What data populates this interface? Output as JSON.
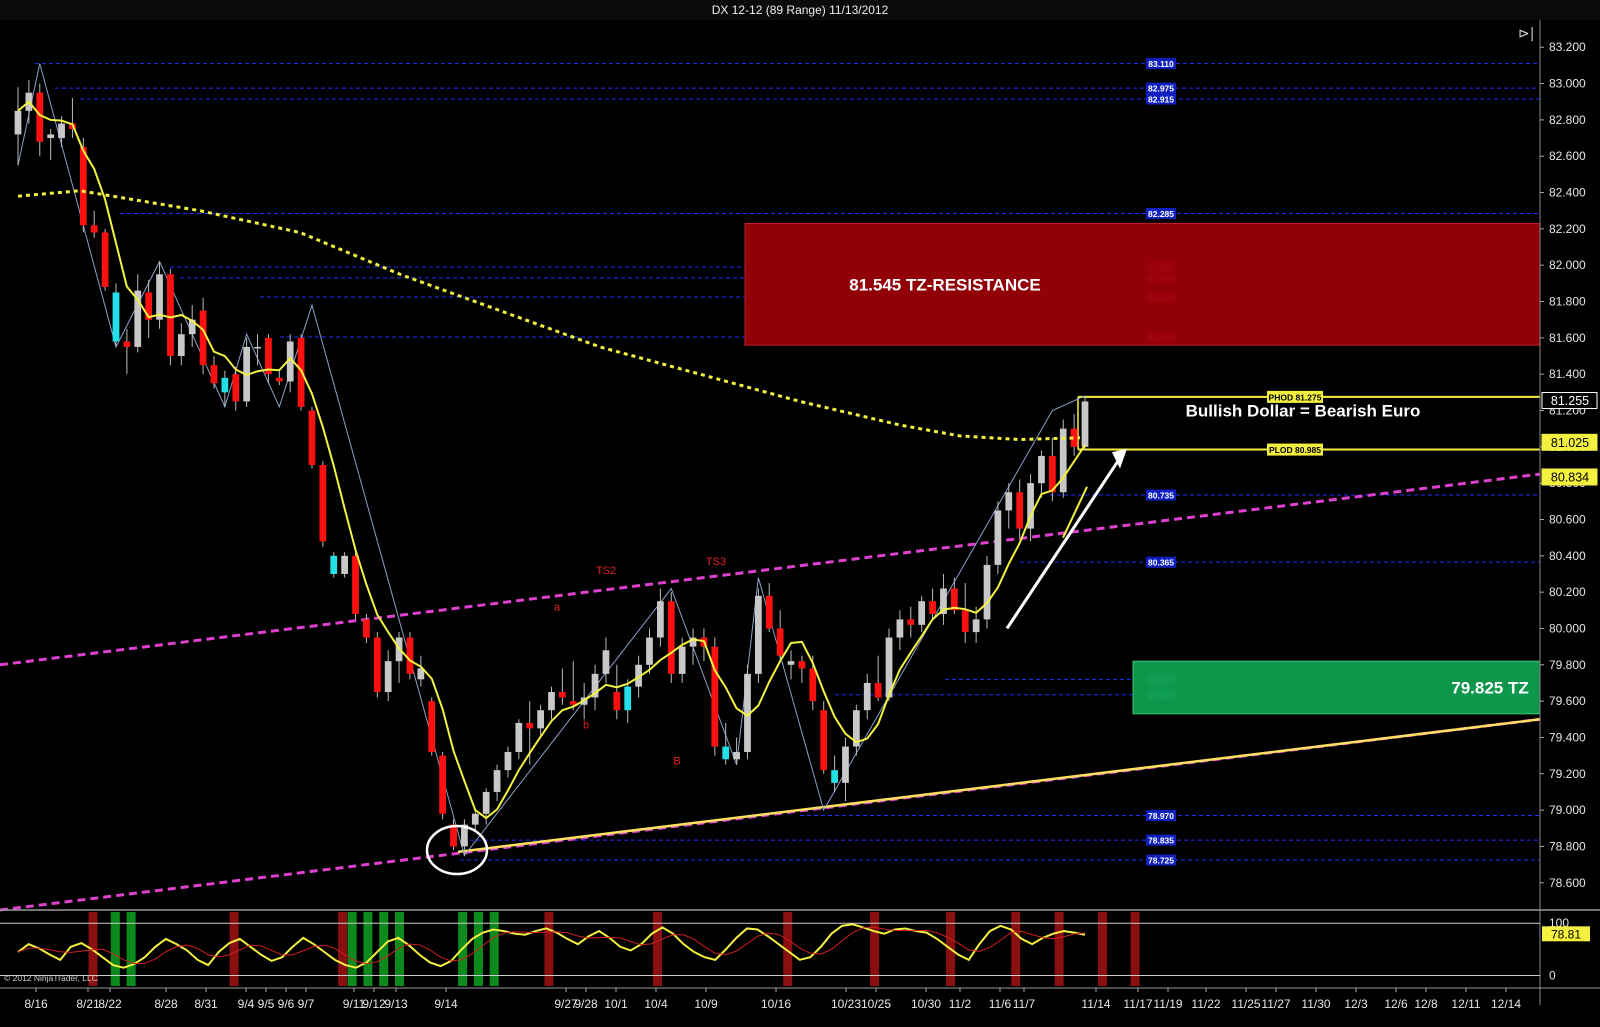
{
  "window": {
    "title": "DX 12-12 (89 Range)  11/13/2012"
  },
  "copyright": "© 2012 NinjaTrader, LLC",
  "colors": {
    "background": "#000000",
    "bull_candle": "#c8c8c8",
    "bear_candle": "#ff1010",
    "highlight_candle": "#22e0e8",
    "fast_ma": "#f2f240",
    "slow_ma": "#f2f240",
    "channel": "#e040d0",
    "level_line": "#2030ff",
    "resistance_zone": "#9a0008",
    "support_zone": "#0fa050"
  },
  "chart_data": {
    "type": "candlestick",
    "instrument": "DX 12-12",
    "ylim": [
      78.45,
      83.35
    ],
    "y_ticks": [
      "83.200",
      "83.000",
      "82.800",
      "82.600",
      "82.400",
      "82.200",
      "82.000",
      "81.800",
      "81.600",
      "81.400",
      "81.200",
      "81.000",
      "80.800",
      "80.600",
      "80.400",
      "80.200",
      "80.000",
      "79.800",
      "79.600",
      "79.400",
      "79.200",
      "79.000",
      "78.800",
      "78.600"
    ],
    "x_labels": [
      "8/16",
      "8/21",
      "8/22",
      "8/28",
      "8/31",
      "9/4",
      "9/5",
      "9/6",
      "9/7",
      "9/11",
      "9/12",
      "9/13",
      "9/14",
      "9/27",
      "9/28",
      "10/1",
      "10/4",
      "10/9",
      "10/16",
      "10/23",
      "10/25",
      "10/30",
      "11/2",
      "11/6",
      "11/7",
      "11/14",
      "11/17",
      "11/19",
      "11/22",
      "11/25",
      "11/27",
      "11/30",
      "12/3",
      "12/6",
      "12/8",
      "12/11",
      "12/14"
    ],
    "price_levels": [
      {
        "label": "83.110",
        "value": 83.11,
        "color": "#2030ff"
      },
      {
        "label": "82.975",
        "value": 82.975,
        "color": "#2030ff"
      },
      {
        "label": "82.915",
        "value": 82.915,
        "color": "#2030ff"
      },
      {
        "label": "82.285",
        "value": 82.285,
        "color": "#2030ff"
      },
      {
        "label": "81.990",
        "value": 81.99,
        "color": "#e050c0"
      },
      {
        "label": "81.930",
        "value": 81.93,
        "color": "#e050c0"
      },
      {
        "label": "81.825",
        "value": 81.825,
        "color": "#e050c0"
      },
      {
        "label": "81.605",
        "value": 81.605,
        "color": "#e050c0"
      },
      {
        "label": "80.735",
        "value": 80.735,
        "color": "#2030ff"
      },
      {
        "label": "80.365",
        "value": 80.365,
        "color": "#2030ff"
      },
      {
        "label": "79.720",
        "value": 79.72,
        "color": "#2aa"
      },
      {
        "label": "79.635",
        "value": 79.635,
        "color": "#2aa"
      },
      {
        "label": "78.970",
        "value": 78.97,
        "color": "#2030ff"
      },
      {
        "label": "78.835",
        "value": 78.835,
        "color": "#2030ff"
      },
      {
        "label": "78.725",
        "value": 78.725,
        "color": "#2030ff"
      }
    ],
    "phod": {
      "label": "PHOD 81.275",
      "value": 81.275
    },
    "plod": {
      "label": "PLOD 80.985",
      "value": 80.985
    },
    "price_tags": [
      {
        "label": "81.255",
        "value": 81.255,
        "style": "white"
      },
      {
        "label": "81.025",
        "value": 81.025,
        "style": "yellow"
      },
      {
        "label": "80.834",
        "value": 80.834,
        "style": "yellow"
      }
    ],
    "zones": [
      {
        "label": "81.545 TZ-RESISTANCE",
        "top": 82.23,
        "bottom": 81.56,
        "type": "resistance"
      },
      {
        "label": "79.825 TZ",
        "top": 79.82,
        "bottom": 79.53,
        "type": "support"
      }
    ],
    "annotations": {
      "headline": "Bullish Dollar = Bearish Euro",
      "markers": [
        "TS2",
        "TS3",
        "a",
        "b",
        "B"
      ]
    },
    "candles": [
      [
        82.72,
        82.98,
        82.55,
        82.85
      ],
      [
        82.85,
        83.02,
        82.78,
        82.95
      ],
      [
        82.95,
        83.0,
        82.6,
        82.68
      ],
      [
        82.7,
        82.75,
        82.58,
        82.72
      ],
      [
        82.7,
        82.82,
        82.65,
        82.78
      ],
      [
        82.78,
        82.92,
        82.7,
        82.75
      ],
      [
        82.65,
        82.7,
        82.18,
        82.22
      ],
      [
        82.22,
        82.3,
        82.15,
        82.18
      ],
      [
        82.18,
        82.2,
        81.86,
        81.88
      ],
      [
        81.85,
        81.9,
        81.55,
        81.58
      ],
      [
        81.58,
        81.65,
        81.4,
        81.55
      ],
      [
        81.55,
        81.95,
        81.52,
        81.86
      ],
      [
        81.85,
        81.92,
        81.6,
        81.7
      ],
      [
        81.7,
        82.02,
        81.65,
        81.95
      ],
      [
        81.95,
        81.98,
        81.45,
        81.5
      ],
      [
        81.5,
        81.68,
        81.45,
        81.62
      ],
      [
        81.62,
        81.78,
        81.55,
        81.7
      ],
      [
        81.75,
        81.82,
        81.4,
        81.45
      ],
      [
        81.45,
        81.5,
        81.32,
        81.35
      ],
      [
        81.3,
        81.42,
        81.22,
        81.38
      ],
      [
        81.4,
        81.44,
        81.2,
        81.25
      ],
      [
        81.25,
        81.6,
        81.22,
        81.55
      ],
      [
        81.55,
        81.62,
        81.45,
        81.55
      ],
      [
        81.6,
        81.62,
        81.35,
        81.4
      ],
      [
        81.38,
        81.42,
        81.34,
        81.36
      ],
      [
        81.36,
        81.62,
        81.3,
        81.58
      ],
      [
        81.6,
        81.62,
        81.2,
        81.22
      ],
      [
        81.2,
        81.22,
        80.88,
        80.9
      ],
      [
        80.9,
        80.92,
        80.45,
        80.48
      ],
      [
        80.4,
        80.42,
        80.28,
        80.3
      ],
      [
        80.3,
        80.42,
        80.28,
        80.4
      ],
      [
        80.4,
        80.45,
        80.05,
        80.08
      ],
      [
        80.05,
        80.08,
        79.92,
        79.95
      ],
      [
        79.95,
        79.98,
        79.62,
        79.65
      ],
      [
        79.65,
        79.88,
        79.6,
        79.82
      ],
      [
        79.82,
        79.98,
        79.7,
        79.95
      ],
      [
        79.95,
        79.98,
        79.72,
        79.75
      ],
      [
        79.72,
        79.85,
        79.68,
        79.78
      ],
      [
        79.6,
        79.62,
        79.3,
        79.32
      ],
      [
        79.3,
        79.32,
        78.95,
        78.98
      ],
      [
        78.92,
        78.95,
        78.78,
        78.8
      ],
      [
        78.8,
        78.95,
        78.75,
        78.92
      ],
      [
        78.92,
        79.0,
        78.88,
        78.98
      ],
      [
        78.98,
        79.12,
        78.92,
        79.1
      ],
      [
        79.1,
        79.25,
        79.05,
        79.22
      ],
      [
        79.22,
        79.35,
        79.18,
        79.32
      ],
      [
        79.32,
        79.5,
        79.28,
        79.48
      ],
      [
        79.48,
        79.6,
        79.25,
        79.45
      ],
      [
        79.45,
        79.58,
        79.4,
        79.55
      ],
      [
        79.55,
        79.68,
        79.5,
        79.65
      ],
      [
        79.65,
        79.78,
        79.58,
        79.62
      ],
      [
        79.6,
        79.82,
        79.55,
        79.58
      ],
      [
        79.58,
        79.7,
        79.5,
        79.62
      ],
      [
        79.62,
        79.8,
        79.55,
        79.75
      ],
      [
        79.75,
        79.95,
        79.7,
        79.88
      ],
      [
        79.65,
        79.8,
        79.5,
        79.55
      ],
      [
        79.55,
        79.72,
        79.48,
        79.68
      ],
      [
        79.68,
        79.85,
        79.62,
        79.8
      ],
      [
        79.8,
        80.0,
        79.75,
        79.95
      ],
      [
        79.95,
        80.22,
        79.9,
        80.15
      ],
      [
        80.15,
        80.2,
        79.7,
        79.75
      ],
      [
        79.75,
        79.95,
        79.7,
        79.9
      ],
      [
        79.9,
        80.0,
        79.8,
        79.95
      ],
      [
        79.95,
        80.0,
        79.82,
        79.9
      ],
      [
        79.9,
        79.95,
        79.3,
        79.35
      ],
      [
        79.35,
        79.48,
        79.25,
        79.28
      ],
      [
        79.28,
        79.4,
        79.25,
        79.32
      ],
      [
        79.32,
        79.8,
        79.28,
        79.75
      ],
      [
        79.75,
        80.22,
        79.7,
        80.18
      ],
      [
        80.18,
        80.25,
        79.98,
        80.0
      ],
      [
        80.0,
        80.1,
        79.82,
        79.85
      ],
      [
        79.8,
        79.88,
        79.72,
        79.82
      ],
      [
        79.82,
        79.85,
        79.7,
        79.78
      ],
      [
        79.78,
        79.85,
        79.55,
        79.6
      ],
      [
        79.55,
        79.6,
        79.2,
        79.22
      ],
      [
        79.22,
        79.3,
        79.1,
        79.15
      ],
      [
        79.15,
        79.4,
        79.05,
        79.35
      ],
      [
        79.35,
        79.58,
        79.3,
        79.55
      ],
      [
        79.55,
        79.75,
        79.5,
        79.7
      ],
      [
        79.7,
        79.85,
        79.6,
        79.62
      ],
      [
        79.62,
        80.0,
        79.6,
        79.95
      ],
      [
        79.95,
        80.1,
        79.88,
        80.05
      ],
      [
        80.05,
        80.12,
        79.95,
        80.02
      ],
      [
        80.02,
        80.18,
        79.98,
        80.15
      ],
      [
        80.15,
        80.22,
        80.05,
        80.08
      ],
      [
        80.08,
        80.3,
        80.02,
        80.22
      ],
      [
        80.22,
        80.28,
        80.08,
        80.1
      ],
      [
        80.1,
        80.25,
        79.92,
        79.98
      ],
      [
        79.98,
        80.12,
        79.92,
        80.05
      ],
      [
        80.05,
        80.4,
        80.0,
        80.35
      ],
      [
        80.35,
        80.7,
        80.3,
        80.65
      ],
      [
        80.65,
        80.8,
        80.55,
        80.75
      ],
      [
        80.75,
        80.82,
        80.5,
        80.55
      ],
      [
        80.55,
        80.85,
        80.48,
        80.8
      ],
      [
        80.8,
        80.98,
        80.72,
        80.95
      ],
      [
        80.95,
        81.05,
        80.7,
        80.75
      ],
      [
        80.75,
        81.15,
        80.72,
        81.1
      ],
      [
        81.1,
        81.18,
        80.95,
        81.0
      ],
      [
        81.0,
        81.28,
        80.98,
        81.25
      ]
    ],
    "oscillator": {
      "ylim": [
        -20,
        110
      ],
      "labels": [
        "100",
        "0"
      ],
      "current": "78.81",
      "values": [
        45,
        60,
        52,
        40,
        30,
        55,
        62,
        50,
        35,
        20,
        15,
        22,
        35,
        55,
        70,
        60,
        48,
        30,
        20,
        45,
        62,
        70,
        55,
        40,
        28,
        35,
        55,
        72,
        60,
        45,
        30,
        20,
        15,
        25,
        45,
        65,
        72,
        58,
        40,
        25,
        18,
        28,
        50,
        70,
        82,
        88,
        85,
        80,
        78,
        85,
        90,
        82,
        70,
        60,
        75,
        85,
        72,
        55,
        48,
        60,
        80,
        92,
        80,
        60,
        45,
        35,
        30,
        50,
        72,
        90,
        88,
        75,
        60,
        45,
        30,
        35,
        55,
        80,
        95,
        98,
        92,
        85,
        80,
        88,
        90,
        85,
        82,
        70,
        55,
        40,
        30,
        60,
        85,
        95,
        88,
        70,
        60,
        72,
        80,
        85,
        82,
        78
      ]
    }
  }
}
